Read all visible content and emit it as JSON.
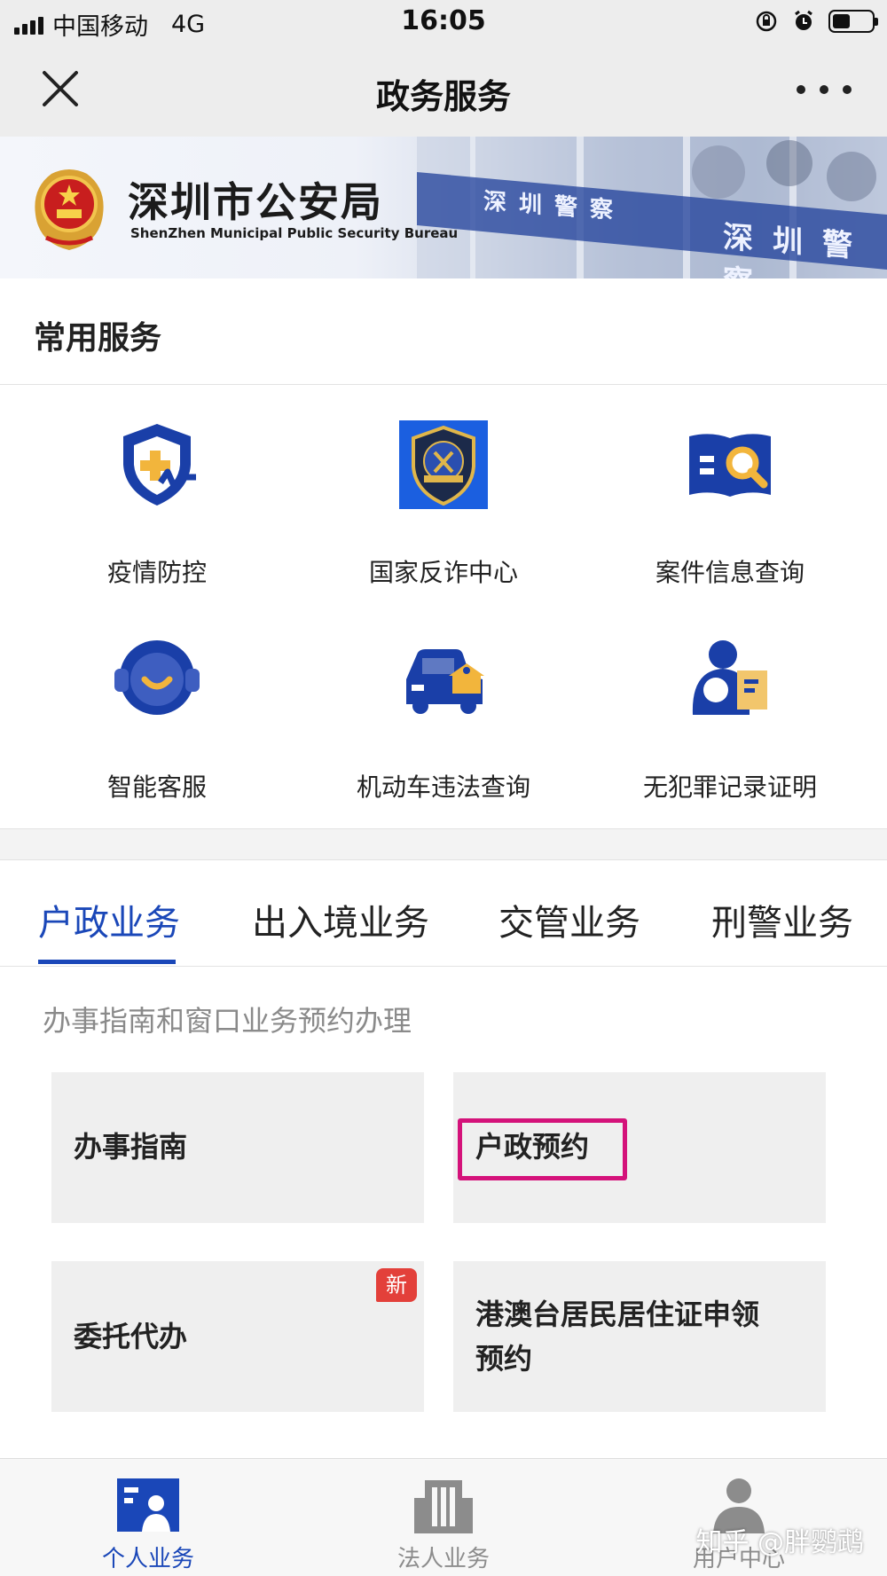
{
  "status_bar": {
    "carrier": "中国移动",
    "network": "4G",
    "time": "16:05",
    "battery_level": 0.45
  },
  "nav": {
    "title": "政务服务",
    "close_icon": "close-icon",
    "more_icon": "more-icon"
  },
  "banner": {
    "title": "深圳市公安局",
    "subtitle": "ShenZhen Municipal Public Security Bureau",
    "sign_text": "深圳警察"
  },
  "common_services": {
    "heading": "常用服务",
    "items": [
      {
        "label": "疫情防控",
        "icon": "epidemic-shield-icon"
      },
      {
        "label": "国家反诈中心",
        "icon": "anti-fraud-badge-icon"
      },
      {
        "label": "案件信息查询",
        "icon": "case-search-icon"
      },
      {
        "label": "智能客服",
        "icon": "customer-service-icon"
      },
      {
        "label": "机动车违法查询",
        "icon": "vehicle-violation-icon"
      },
      {
        "label": "无犯罪记录证明",
        "icon": "no-crime-certificate-icon"
      }
    ]
  },
  "business_tabs": {
    "items": [
      "户政业务",
      "出入境业务",
      "交管业务",
      "刑警业务"
    ],
    "active": "户政业务"
  },
  "guide_note": "办事指南和窗口业务预约办理",
  "cards": [
    {
      "label": "办事指南"
    },
    {
      "label": "户政预约",
      "highlighted": true
    },
    {
      "label": "委托代办",
      "badge": "新"
    },
    {
      "label": "港澳台居民居住证申领预约"
    }
  ],
  "bottom_tabs": [
    {
      "label": "个人业务",
      "icon": "personal-business-icon",
      "active": true
    },
    {
      "label": "法人业务",
      "icon": "corporate-building-icon",
      "active": false
    },
    {
      "label": "用户中心",
      "icon": "user-center-icon",
      "active": false
    }
  ],
  "watermark": "知乎 @胖鹦鹉",
  "colors": {
    "accent": "#1a47b8",
    "highlight": "#d4127a",
    "badge": "#e3403a",
    "gold": "#f2b53c"
  }
}
